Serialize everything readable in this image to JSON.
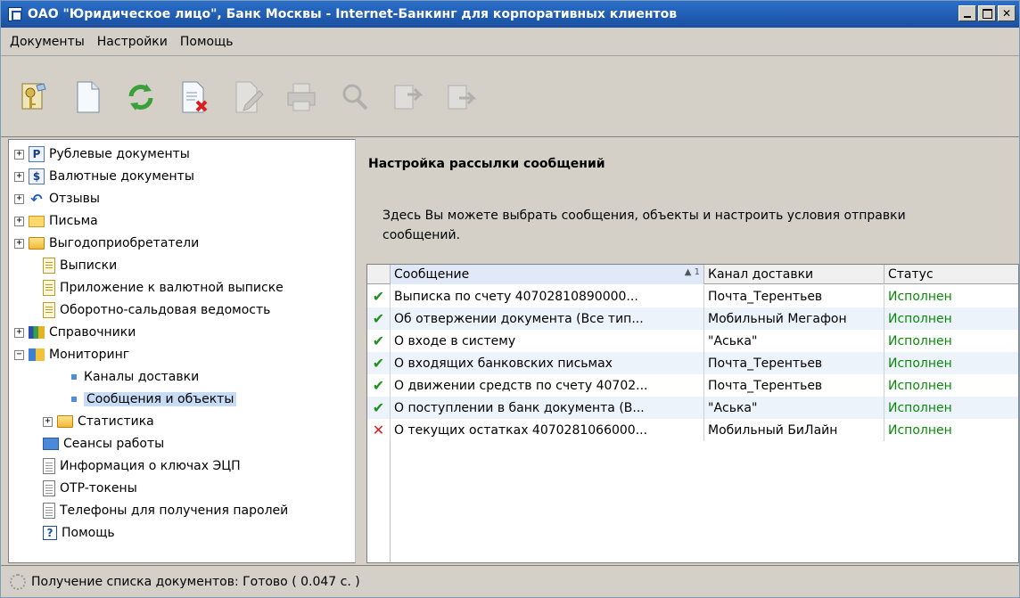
{
  "window": {
    "title": "ОАО \"Юридическое лицо\", Банк Москвы - Internet-Банкинг для корпоративных клиентов",
    "controls": {
      "minimize": "_",
      "maximize": "□",
      "close": "✕"
    }
  },
  "menu": {
    "items": [
      "Документы",
      "Настройки",
      "Помощь"
    ]
  },
  "toolbar": {
    "tools": [
      "keys-icon",
      "new-document-icon",
      "refresh-icon",
      "delete-document-icon",
      "edit-document-icon",
      "print-icon",
      "search-icon",
      "import-icon",
      "export-icon"
    ]
  },
  "tree": {
    "items": [
      {
        "label": "Рублевые документы",
        "icon": "ruble-doc-icon",
        "glyph": "Р",
        "expander": "+"
      },
      {
        "label": "Валютные документы",
        "icon": "currency-doc-icon",
        "glyph": "$",
        "expander": "+"
      },
      {
        "label": "Отзывы",
        "icon": "back-arrow-icon",
        "glyph": "↶",
        "expander": "+"
      },
      {
        "label": "Письма",
        "icon": "envelope-icon",
        "glyph": "",
        "expander": "+"
      },
      {
        "label": "Выгодоприобретатели",
        "icon": "folder-icon",
        "glyph": "",
        "expander": "+"
      },
      {
        "label": "Выписки",
        "icon": "statement-icon",
        "glyph": "",
        "expander": ""
      },
      {
        "label": "Приложение к валютной выписке",
        "icon": "statement-icon",
        "glyph": "",
        "expander": ""
      },
      {
        "label": "Оборотно-сальдовая ведомость",
        "icon": "statement-icon",
        "glyph": "",
        "expander": ""
      },
      {
        "label": "Справочники",
        "icon": "books-icon",
        "glyph": "",
        "expander": "+"
      },
      {
        "label": "Мониторинг",
        "icon": "monitoring-icon",
        "glyph": "",
        "expander": "−"
      },
      {
        "label": "Каналы доставки",
        "icon": "bullet-icon",
        "glyph": "",
        "expander": ""
      },
      {
        "label": "Сообщения и объекты",
        "icon": "bullet-icon",
        "glyph": "",
        "expander": ""
      },
      {
        "label": "Статистика",
        "icon": "folder-icon",
        "glyph": "",
        "expander": "+"
      },
      {
        "label": "Сеансы работы",
        "icon": "monitor-icon",
        "glyph": "",
        "expander": ""
      },
      {
        "label": "Информация о ключах ЭЦП",
        "icon": "document-icon",
        "glyph": "",
        "expander": ""
      },
      {
        "label": "OTP-токены",
        "icon": "document-icon",
        "glyph": "",
        "expander": ""
      },
      {
        "label": "Телефоны для получения паролей",
        "icon": "document-icon",
        "glyph": "",
        "expander": ""
      },
      {
        "label": "Помощь",
        "icon": "help-icon",
        "glyph": "?",
        "expander": ""
      }
    ]
  },
  "panel": {
    "title": "Настройка рассылки сообщений",
    "description": "Здесь Вы можете выбрать сообщения, объекты и настроить условия отправки сообщений."
  },
  "grid": {
    "columns": [
      "Сообщение",
      "Канал доставки",
      "Статус"
    ],
    "sort_indicator": "▲ 1",
    "rows": [
      {
        "mark": "✔",
        "mark_type": "ok",
        "message": "Выписка по счету 40702810890000...",
        "channel": "Почта_Терентьев",
        "status": "Исполнен"
      },
      {
        "mark": "✔",
        "mark_type": "ok",
        "message": "Об отвержении документа (Все тип...",
        "channel": "Мобильный Мегафон",
        "status": "Исполнен"
      },
      {
        "mark": "✔",
        "mark_type": "ok",
        "message": "О входе в систему",
        "channel": "\"Аська\"",
        "status": "Исполнен"
      },
      {
        "mark": "✔",
        "mark_type": "ok",
        "message": "О входящих банковских письмах",
        "channel": "Почта_Терентьев",
        "status": "Исполнен"
      },
      {
        "mark": "✔",
        "mark_type": "ok",
        "message": "О движении средств по счету 40702...",
        "channel": "Почта_Терентьев",
        "status": "Исполнен"
      },
      {
        "mark": "✔",
        "mark_type": "ok",
        "message": "О поступлении в банк документа (В...",
        "channel": "\"Аська\"",
        "status": "Исполнен"
      },
      {
        "mark": "✕",
        "mark_type": "err",
        "message": "О текущих остатках 4070281066000...",
        "channel": "Мобильный БиЛайн",
        "status": "Исполнен"
      }
    ]
  },
  "status": {
    "text": "Получение списка документов: Готово ( 0.047 с. )"
  },
  "colors": {
    "titlebar": "#1a4fa0",
    "status_ok": "#0a8a0a",
    "mark_ok": "#1f8f1f",
    "mark_err": "#d81f1f",
    "selection": "#c6dcf5"
  }
}
